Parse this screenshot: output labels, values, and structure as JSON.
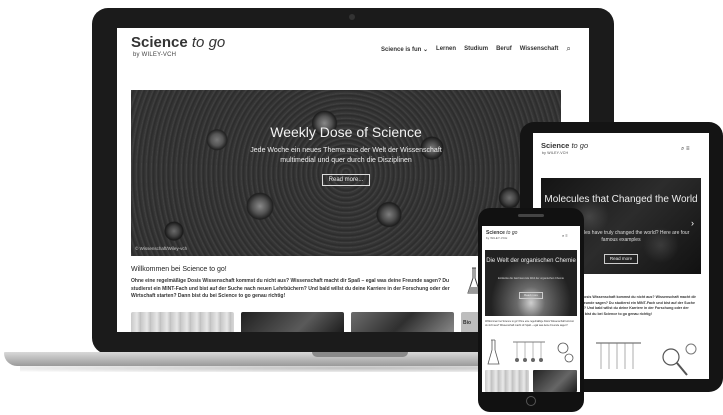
{
  "laptop": {
    "logo_main": "Science",
    "logo_italic": "to go",
    "logo_sub": "by WILEY-VCH",
    "nav": [
      {
        "label": "Science is fun ⌄"
      },
      {
        "label": "Lernen"
      },
      {
        "label": "Studium"
      },
      {
        "label": "Beruf"
      },
      {
        "label": "Wissenschaft"
      }
    ],
    "search_icon": "⌕",
    "hero": {
      "title": "Weekly Dose of Science",
      "text": "Jede Woche ein neues Thema aus der Welt der Wissenschaft multimedial und quer durch die Disziplinen",
      "button": "Read more...",
      "credit": "© Wissenschaft/Wiley-vch"
    },
    "welcome": "Willkommen bei Science to go!",
    "intro": "Ohne eine regelmäßige Dosis Wissenschaft kommst du nicht aus? Wissenschaft macht dir Spaß – egal was deine Freunde sagen? Du studierst ein MINT-Fach und bist auf der Suche nach neuen Lehrbüchern? Und bald willst du deine Karriere in der Forschung oder der Wirtschaft starten? Dann bist du bei Science to go genau richtig!",
    "tile_label": "Bio"
  },
  "tablet": {
    "logo_main": "Science",
    "logo_italic": "to go",
    "logo_sub": "by WILEY-VCH",
    "icons": "⌕   ≡",
    "hero": {
      "title": "Molecules that Changed the World",
      "text": "Which molecules have truly changed the world? Here are four famous examples",
      "button": "Read more"
    },
    "chevron": "›",
    "text": "Ohne eine regelmäßige Dosis Wissenschaft kommst du nicht aus? Wissenschaft macht dir Spaß – egal was deine Freunde sagen? Du studierst ein MINT-Fach und bist auf der Suche nach neuen Lehrbüchern? Und bald willst du deine Karriere in der Forschung oder der Wirtschaft starten? Dann bist du bei Science to go genau richtig!"
  },
  "phone": {
    "logo_main": "Science",
    "logo_italic": "to go",
    "logo_sub": "by WILEY-VCH",
    "icons": "⌕ ≡",
    "hero": {
      "title": "Die Welt der organischen Chemie",
      "text": "Entdecke die faszinierende Welt der organischen Chemie",
      "button": "Read more"
    },
    "text": "Willkommen bei Science to go! Ohne eine regelmäßige Dosis Wissenschaft kommst du nicht aus? Wissenschaft macht dir Spaß – egal was deine Freunde sagen?"
  }
}
